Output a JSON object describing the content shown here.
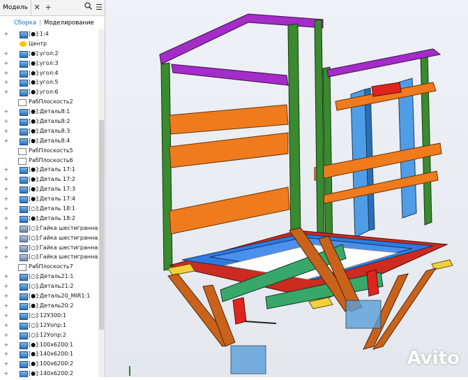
{
  "tabs": {
    "model": "Модель",
    "add": "+"
  },
  "subtabs": {
    "assembly": "Сборка",
    "modeling": "Моделирование"
  },
  "tree": [
    {
      "type": "part",
      "label": "[●]:1:4"
    },
    {
      "type": "center",
      "label": "Центр"
    },
    {
      "type": "part",
      "label": "[●]:угол:2"
    },
    {
      "type": "part",
      "label": "[●]:угол:3"
    },
    {
      "type": "part",
      "label": "[●]:угол:4"
    },
    {
      "type": "part",
      "label": "[●]:угол:5"
    },
    {
      "type": "part",
      "label": "[●]:угол:6"
    },
    {
      "type": "plane",
      "label": "РабПлоскость2"
    },
    {
      "type": "part",
      "label": "[●]:Деталь8:1"
    },
    {
      "type": "part",
      "label": "[●]:Деталь8:2"
    },
    {
      "type": "part",
      "label": "[●]:Деталь8:3"
    },
    {
      "type": "part",
      "label": "[●]:Деталь8:4"
    },
    {
      "type": "plane",
      "label": "РабПлоскость5"
    },
    {
      "type": "plane",
      "label": "РабПлоскость6"
    },
    {
      "type": "part",
      "label": "[●]:Деталь 17:1"
    },
    {
      "type": "part",
      "label": "[●]:Деталь 17:2"
    },
    {
      "type": "part",
      "label": "[●]:Деталь 17:3"
    },
    {
      "type": "part",
      "label": "[●]:Деталь 17:4"
    },
    {
      "type": "part",
      "label": "[○]:Деталь 18:1"
    },
    {
      "type": "part",
      "label": "[●]:Деталь 18:2"
    },
    {
      "type": "nut",
      "label": "[○]:Гайка шестигранная тя"
    },
    {
      "type": "nut",
      "label": "[○]:Гайка шестигранная тя"
    },
    {
      "type": "nut",
      "label": "[○]:Гайка шестигранная тя"
    },
    {
      "type": "nut",
      "label": "[○]:Гайка шестигранная тя"
    },
    {
      "type": "plane",
      "label": "РабПлоскость7"
    },
    {
      "type": "part",
      "label": "[○]:Деталь21:1"
    },
    {
      "type": "part",
      "label": "[○]:Деталь21:2"
    },
    {
      "type": "part",
      "label": "[●]:Деталь20_MIR1:1"
    },
    {
      "type": "part",
      "label": "[●]:Деталь20:2"
    },
    {
      "type": "part",
      "label": "[○]:12У300:1"
    },
    {
      "type": "part",
      "label": "[○]:12Уопр:1"
    },
    {
      "type": "part",
      "label": "[○]:12Уопр:2"
    },
    {
      "type": "part",
      "label": "[●]:100x6200:1"
    },
    {
      "type": "part",
      "label": "[●]:140x6200:1"
    },
    {
      "type": "part",
      "label": "[●]:100x6200:2"
    },
    {
      "type": "part",
      "label": "[●]:140x6200:2"
    }
  ],
  "watermark": "Avito"
}
